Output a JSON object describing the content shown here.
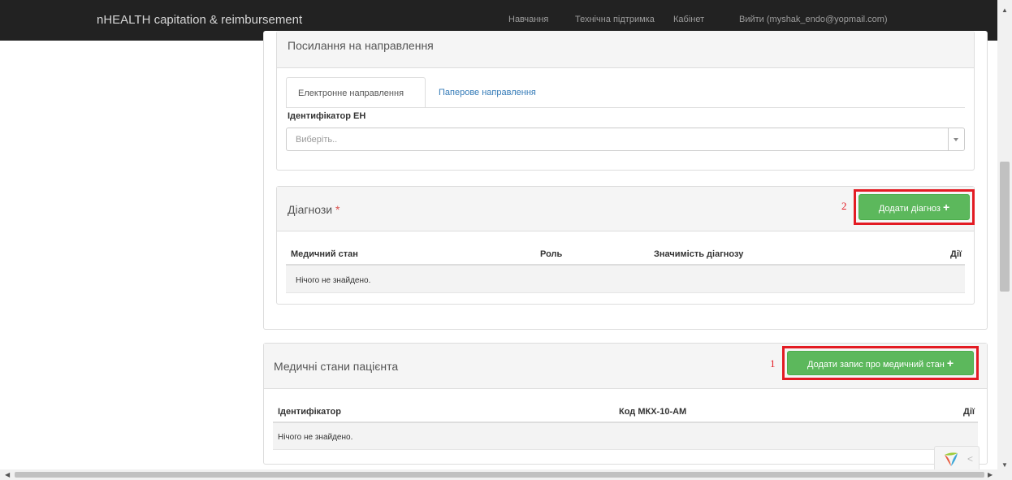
{
  "navbar": {
    "brand": "nHEALTH capitation & reimbursement",
    "links": [
      "Навчання",
      "Технічна підтримка",
      "Кабінет",
      "Вийти (myshak_endo@yopmail.com)"
    ]
  },
  "referral": {
    "heading": "Посилання на направлення",
    "tabs": [
      "Електронне направлення",
      "Паперове направлення"
    ],
    "field_label": "Ідентифікатор ЕН",
    "select_placeholder": "Виберіть.."
  },
  "diagnoses": {
    "heading": "Діагнози",
    "required_mark": "*",
    "add_button": "Додати діагноз",
    "annotation": "2",
    "columns": [
      "Медичний стан",
      "Роль",
      "Значимість діагнозу",
      "Дії"
    ],
    "empty_text": "Нічого не знайдено."
  },
  "conditions": {
    "heading": "Медичні стани пацієнта",
    "add_button": "Додати запис про медичний стан",
    "annotation": "1",
    "columns": [
      "Ідентифікатор",
      "Код МКХ-10-АМ",
      "Дії"
    ],
    "empty_text": "Нічого не знайдено."
  },
  "colors": {
    "navbar": "#222222",
    "button": "#5cb85c",
    "annotation": "#e31b23",
    "link": "#337ab7"
  },
  "icons": [
    "plus-icon",
    "yii-logo",
    "chevron-left-icon",
    "dropdown-caret-icon"
  ]
}
